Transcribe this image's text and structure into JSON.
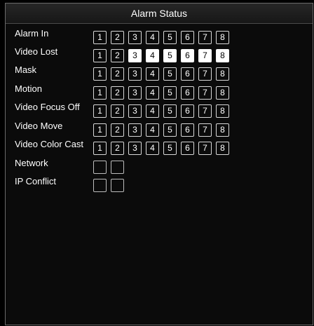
{
  "window": {
    "title": "Alarm Status"
  },
  "rows": [
    {
      "label": "Alarm In",
      "channels": [
        "1",
        "2",
        "3",
        "4",
        "5",
        "6",
        "7",
        "8"
      ],
      "active": []
    },
    {
      "label": "Video Lost",
      "channels": [
        "1",
        "2",
        "3",
        "4",
        "5",
        "6",
        "7",
        "8"
      ],
      "active": [
        "3",
        "4",
        "5",
        "6",
        "7",
        "8"
      ]
    },
    {
      "label": "Mask",
      "channels": [
        "1",
        "2",
        "3",
        "4",
        "5",
        "6",
        "7",
        "8"
      ],
      "active": []
    },
    {
      "label": "Motion",
      "channels": [
        "1",
        "2",
        "3",
        "4",
        "5",
        "6",
        "7",
        "8"
      ],
      "active": []
    },
    {
      "label": "Video Focus Off",
      "channels": [
        "1",
        "2",
        "3",
        "4",
        "5",
        "6",
        "7",
        "8"
      ],
      "active": []
    },
    {
      "label": "Video Move",
      "channels": [
        "1",
        "2",
        "3",
        "4",
        "5",
        "6",
        "7",
        "8"
      ],
      "active": []
    },
    {
      "label": "Video Color Cast",
      "channels": [
        "1",
        "2",
        "3",
        "4",
        "5",
        "6",
        "7",
        "8"
      ],
      "active": []
    },
    {
      "label": "Network",
      "channels": [
        "",
        ""
      ],
      "active": []
    },
    {
      "label": "IP Conflict",
      "channels": [
        "",
        ""
      ],
      "active": []
    }
  ],
  "colors": {
    "background": "#000000",
    "active_indicator": "#ffffff",
    "indicator_border": "#d8d8d8"
  }
}
